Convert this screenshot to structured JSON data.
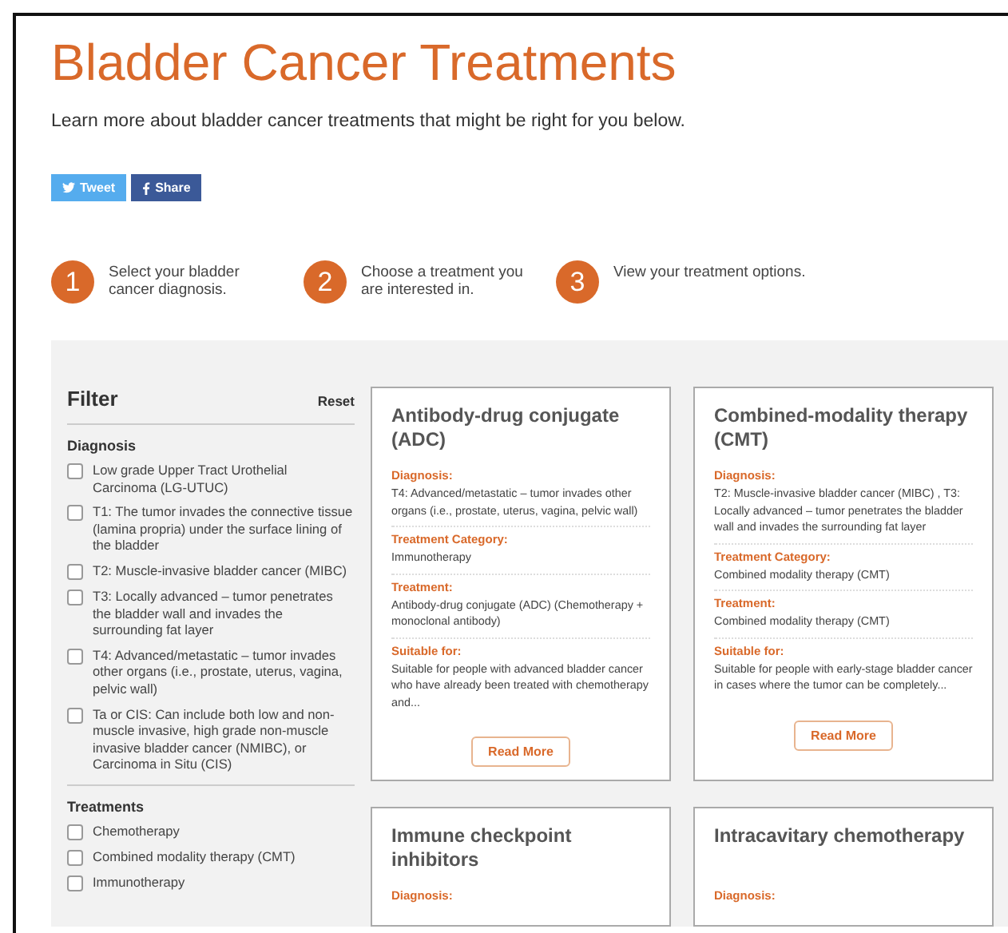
{
  "title": "Bladder Cancer Treatments",
  "intro": "Learn more about bladder cancer treatments that might be right for you below.",
  "share_buttons": [
    {
      "kind": "twitter",
      "label": "Tweet"
    },
    {
      "kind": "facebook",
      "label": "Share"
    }
  ],
  "steps": [
    {
      "number": "1",
      "text": "Select your bladder cancer diagnosis."
    },
    {
      "number": "2",
      "text": "Choose a treatment you are interested in."
    },
    {
      "number": "3",
      "text": "View your treatment options."
    }
  ],
  "filter": {
    "title": "Filter",
    "reset": "Reset",
    "groups": [
      {
        "title": "Diagnosis",
        "options": [
          {
            "label": "Low grade Upper Tract Urothelial Carcinoma (LG-UTUC)",
            "checked": false
          },
          {
            "label": "T1: The tumor invades the connective tissue (lamina propria) under the surface lining of the bladder",
            "checked": false
          },
          {
            "label": "T2: Muscle-invasive bladder cancer (MIBC)",
            "checked": false
          },
          {
            "label": "T3: Locally advanced – tumor penetrates the bladder wall and invades the surrounding fat layer",
            "checked": false
          },
          {
            "label": "T4: Advanced/metastatic – tumor invades other organs (i.e., prostate, uterus, vagina, pelvic wall)",
            "checked": false
          },
          {
            "label": "Ta or CIS: Can include both low and non-muscle invasive, high grade non-muscle invasive bladder cancer (NMIBC), or Carcinoma in Situ (CIS)",
            "checked": false
          }
        ]
      },
      {
        "title": "Treatments",
        "options": [
          {
            "label": "Chemotherapy",
            "checked": false
          },
          {
            "label": "Combined modality therapy (CMT)",
            "checked": false
          },
          {
            "label": "Immunotherapy",
            "checked": false
          }
        ]
      }
    ]
  },
  "cards": [
    {
      "title": "Antibody-drug conjugate (ADC)",
      "sections": [
        {
          "label": "Diagnosis:",
          "text": "T4: Advanced/metastatic – tumor invades other organs (i.e., prostate, uterus, vagina, pelvic wall)"
        },
        {
          "label": "Treatment Category:",
          "text": "Immunotherapy"
        },
        {
          "label": "Treatment:",
          "text": "Antibody-drug conjugate (ADC) (Chemotherapy + monoclonal antibody)"
        },
        {
          "label": "Suitable for:",
          "text": "Suitable for people with advanced bladder cancer who have already been treated with chemotherapy and..."
        }
      ],
      "button": "Read More"
    },
    {
      "title": "Combined-modality therapy (CMT)",
      "sections": [
        {
          "label": "Diagnosis:",
          "text": "T2: Muscle-invasive bladder cancer (MIBC) , T3: Locally advanced – tumor penetrates the bladder wall and invades the surrounding fat layer"
        },
        {
          "label": "Treatment Category:",
          "text": "Combined modality therapy (CMT)"
        },
        {
          "label": "Treatment:",
          "text": "Combined modality therapy (CMT)"
        },
        {
          "label": "Suitable for:",
          "text": "Suitable for people with early-stage bladder cancer in cases where the tumor can be completely..."
        }
      ],
      "button": "Read More"
    },
    {
      "title": "Immune checkpoint inhibitors",
      "sections": [
        {
          "label": "Diagnosis:"
        }
      ]
    },
    {
      "title": "Intracavitary chemotherapy",
      "sections": [
        {
          "label": "Diagnosis:"
        }
      ]
    }
  ]
}
